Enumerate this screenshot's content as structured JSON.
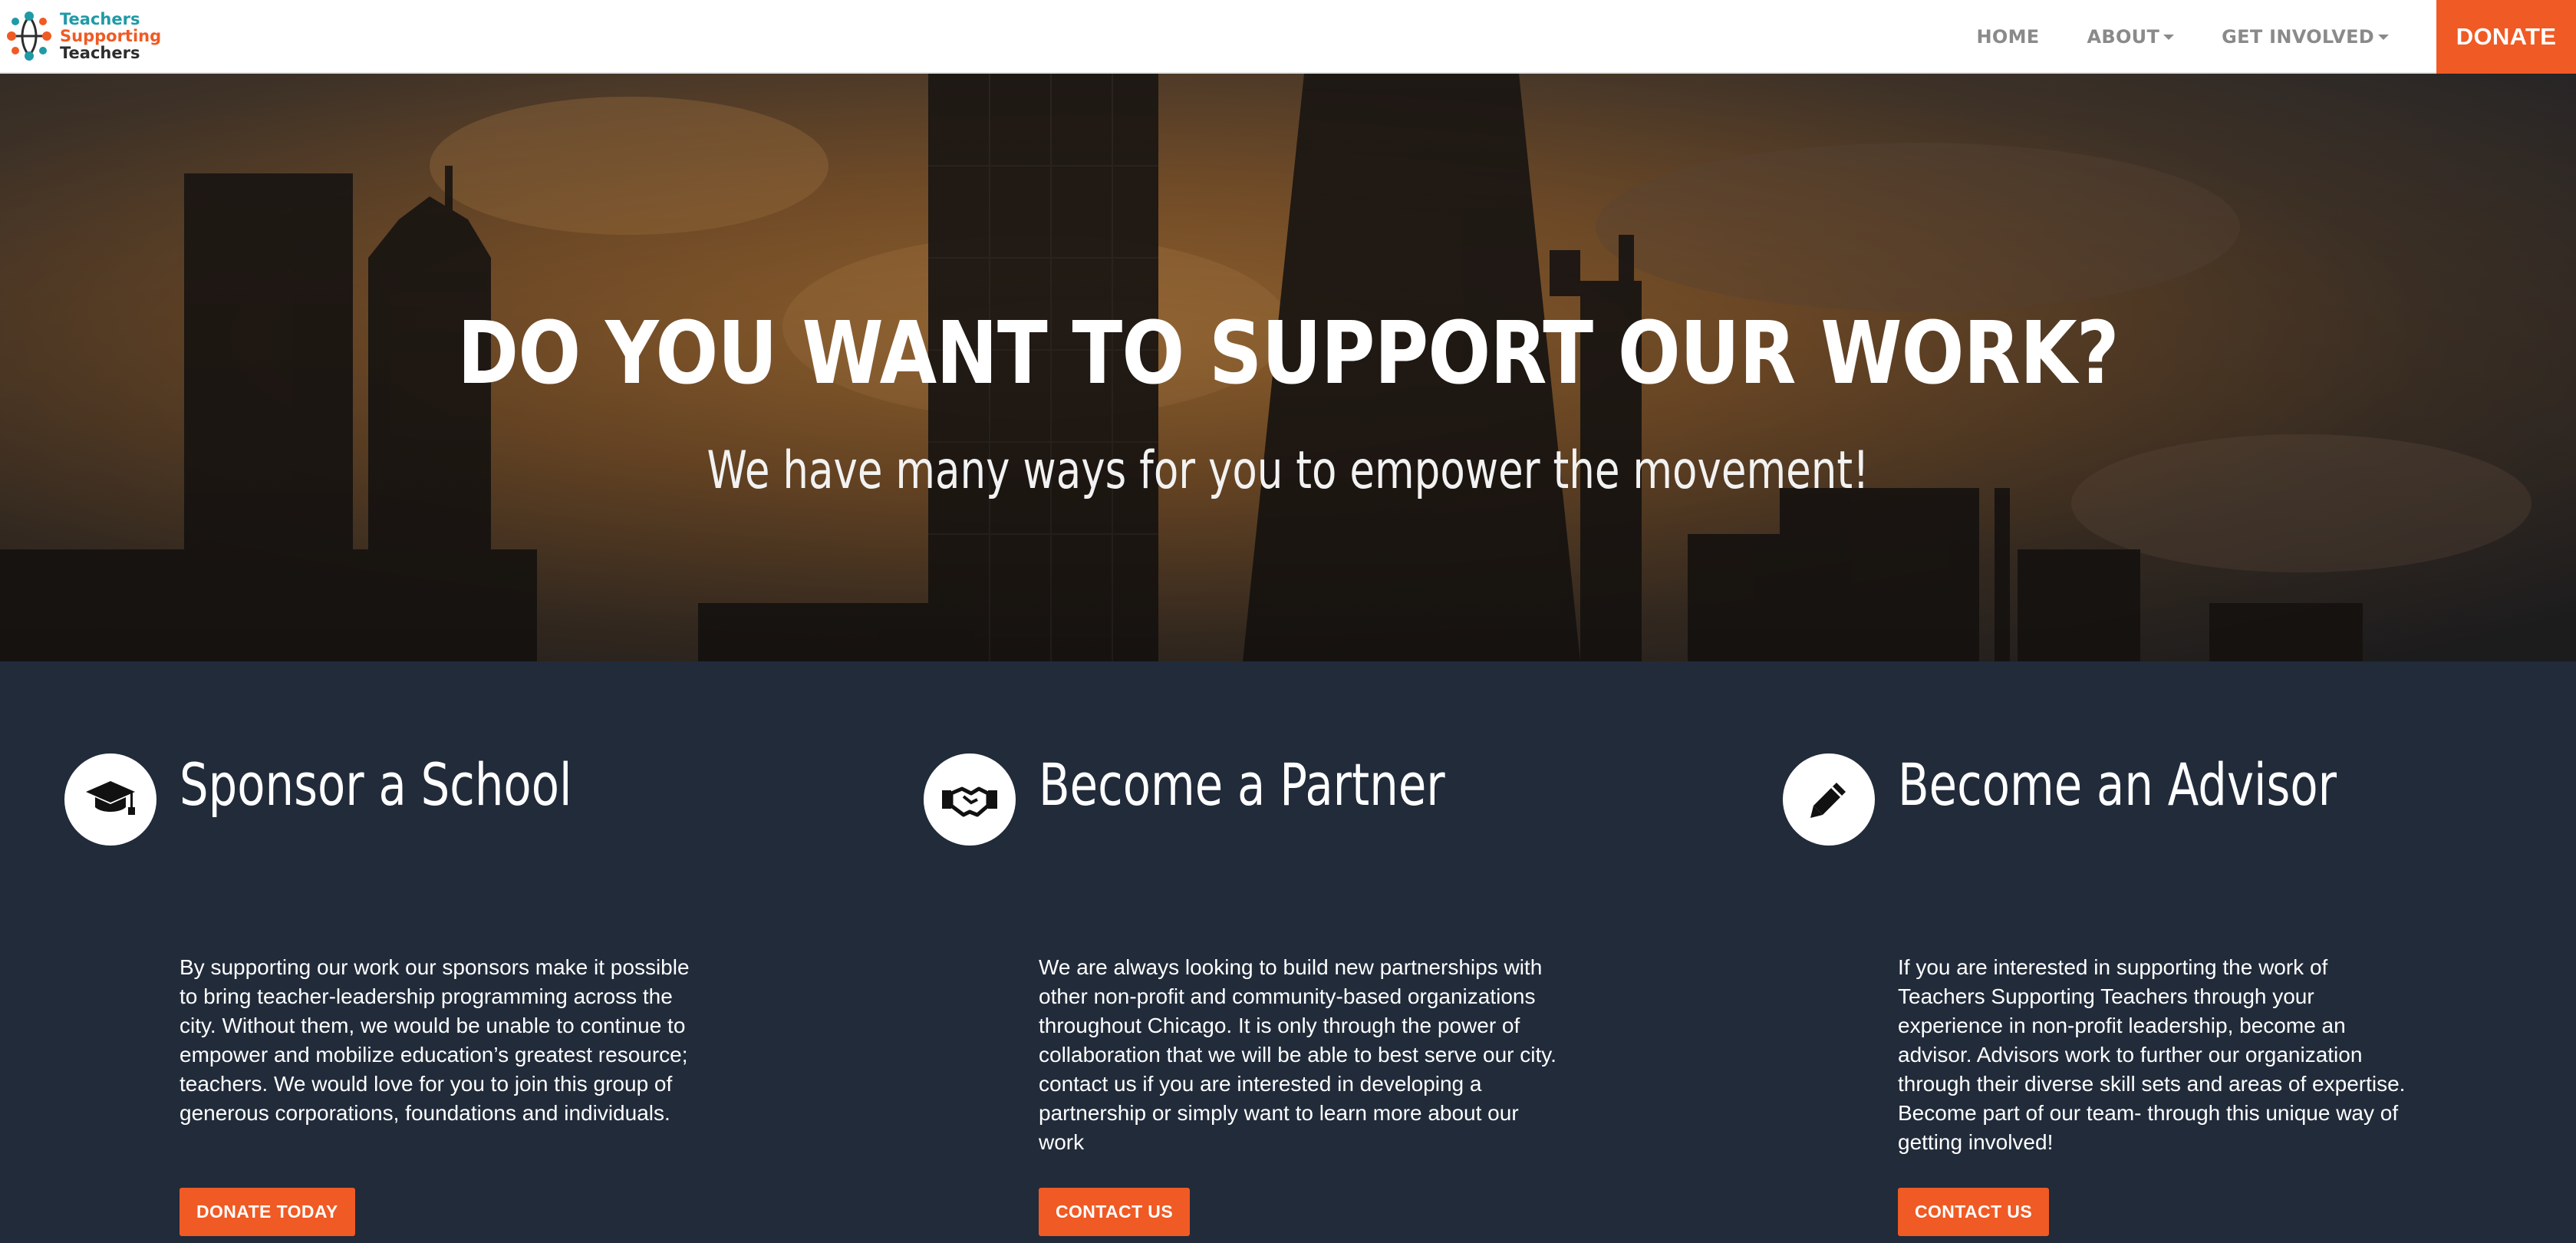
{
  "logo": {
    "line1": "Teachers",
    "line2": "Supporting",
    "line3": "Teachers"
  },
  "nav": {
    "home": "HOME",
    "about": "ABOUT",
    "get_involved": "GET INVOLVED",
    "donate": "DONATE"
  },
  "hero": {
    "title": "DO YOU WANT TO SUPPORT OUR WORK?",
    "subtitle": "We have many ways for you to empower the movement!"
  },
  "features": [
    {
      "icon": "graduation-cap-icon",
      "title": "Sponsor a School",
      "text": "By supporting our work our sponsors make it possible to bring teacher-leadership programming across the city. Without them, we would be unable to continue to empower and mobilize education’s greatest resource; teachers. We would love for you to join this group of generous corporations, foundations and individuals.",
      "button": "DONATE TODAY"
    },
    {
      "icon": "handshake-icon",
      "title": "Become a Partner",
      "text": "We are always looking to build new partnerships with other non-profit and community-based organizations throughout Chicago. It is only through the power of collaboration that we will be able to best serve our city. contact us if you are interested in developing a partnership or simply want to learn more about our work",
      "button": "CONTACT US"
    },
    {
      "icon": "pencil-icon",
      "title": "Become an Advisor",
      "text": "If you are interested in supporting the work of Teachers Supporting Teachers through your experience in non-profit leadership, become an advisor. Advisors work to further our organization through their diverse skill sets and areas of expertise. Become part of our team- through this unique way of getting involved!",
      "button": "CONTACT US"
    }
  ],
  "colors": {
    "accent": "#f05a24",
    "teal": "#1f9aa6",
    "dark": "#212b3a"
  }
}
